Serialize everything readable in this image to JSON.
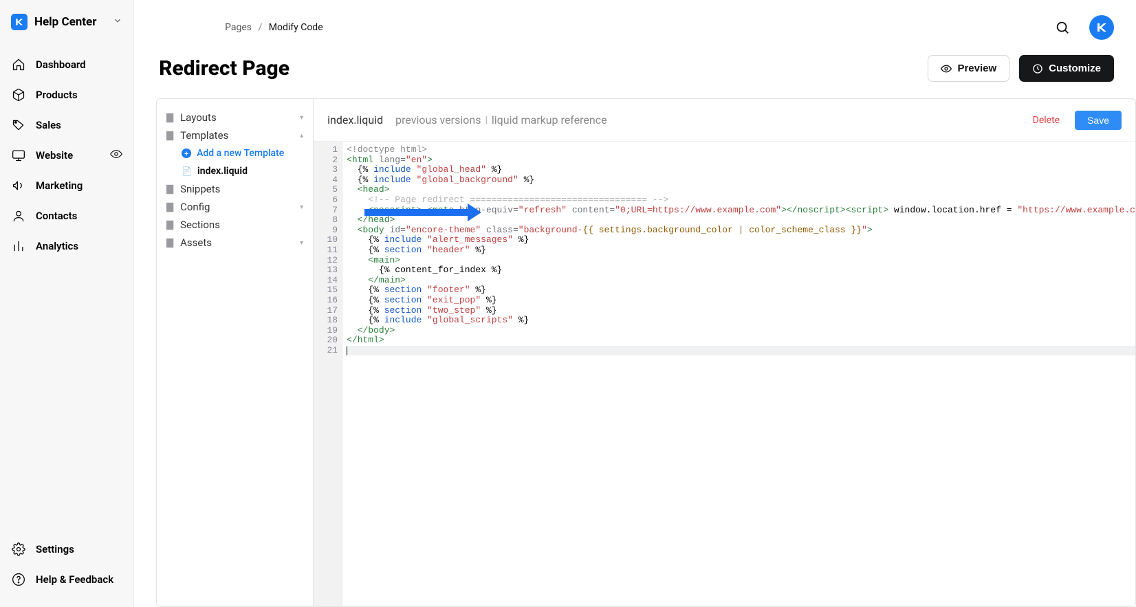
{
  "app_title": "Help Center",
  "nav": [
    {
      "label": "Dashboard",
      "icon": "home"
    },
    {
      "label": "Products",
      "icon": "box"
    },
    {
      "label": "Sales",
      "icon": "tag"
    },
    {
      "label": "Website",
      "icon": "monitor",
      "trailing": "eye"
    },
    {
      "label": "Marketing",
      "icon": "megaphone"
    },
    {
      "label": "Contacts",
      "icon": "user"
    },
    {
      "label": "Analytics",
      "icon": "bars"
    }
  ],
  "footer_nav": [
    {
      "label": "Settings",
      "icon": "gear"
    },
    {
      "label": "Help & Feedback",
      "icon": "question"
    }
  ],
  "breadcrumb": {
    "parent": "Pages",
    "sep": "/",
    "current": "Modify Code"
  },
  "page_title": "Redirect Page",
  "actions": {
    "preview": "Preview",
    "customize": "Customize"
  },
  "tree": {
    "folders": [
      "Layouts",
      "Templates",
      "Snippets",
      "Config",
      "Sections",
      "Assets"
    ],
    "add_template": "Add a new Template",
    "current_file": "index.liquid"
  },
  "editor_header": {
    "filename": "index.liquid",
    "prev": "previous versions",
    "ref": "liquid markup reference",
    "delete": "Delete",
    "save": "Save"
  },
  "code_lines": [
    [
      [
        "s-gray",
        "<!doctype html>"
      ]
    ],
    [
      [
        "s-tag",
        "<html "
      ],
      [
        "s-attr",
        "lang="
      ],
      [
        "s-str",
        "\"en\""
      ],
      [
        "s-tag",
        ">"
      ]
    ],
    [
      [
        "s-text",
        "  {% "
      ],
      [
        "s-kw",
        "include"
      ],
      [
        "s-text",
        " "
      ],
      [
        "s-str",
        "\"global_head\""
      ],
      [
        "s-text",
        " %}"
      ]
    ],
    [
      [
        "s-text",
        "  {% "
      ],
      [
        "s-kw",
        "include"
      ],
      [
        "s-text",
        " "
      ],
      [
        "s-str",
        "\"global_background\""
      ],
      [
        "s-text",
        " %}"
      ]
    ],
    [
      [
        "s-tag",
        "  <head>"
      ]
    ],
    [
      [
        "s-comment",
        "    <!-- Page redirect ================================= -->"
      ]
    ],
    [
      [
        "s-text",
        "    "
      ],
      [
        "s-tag",
        "<noscript>"
      ],
      [
        "s-text",
        " "
      ],
      [
        "s-tag",
        "<meta "
      ],
      [
        "s-attr",
        "http-equiv="
      ],
      [
        "s-str",
        "\"refresh\""
      ],
      [
        "s-text",
        " "
      ],
      [
        "s-attr",
        "content="
      ],
      [
        "s-str",
        "\"0;URL=https://www.example.com\""
      ],
      [
        "s-tag",
        "></noscript><script"
      ],
      [
        "s-tag",
        ">"
      ],
      [
        "s-text",
        " window.location.href = "
      ],
      [
        "s-str",
        "\"https://www.example.c"
      ]
    ],
    [
      [
        "s-tag",
        "  </head>"
      ]
    ],
    [
      [
        "s-tag",
        "  <body "
      ],
      [
        "s-attr",
        "id="
      ],
      [
        "s-str",
        "\"encore-theme\""
      ],
      [
        "s-text",
        " "
      ],
      [
        "s-attr",
        "class="
      ],
      [
        "s-str",
        "\"background-"
      ],
      [
        "s-liq",
        "{{ settings.background_color | color_scheme_class }}"
      ],
      [
        "s-str",
        "\""
      ],
      [
        "s-tag",
        ">"
      ]
    ],
    [
      [
        "s-text",
        "    {% "
      ],
      [
        "s-kw",
        "include"
      ],
      [
        "s-text",
        " "
      ],
      [
        "s-str",
        "\"alert_messages\""
      ],
      [
        "s-text",
        " %}"
      ]
    ],
    [
      [
        "s-text",
        "    {% "
      ],
      [
        "s-kw",
        "section"
      ],
      [
        "s-text",
        " "
      ],
      [
        "s-str",
        "\"header\""
      ],
      [
        "s-text",
        " %}"
      ]
    ],
    [
      [
        "s-tag",
        "    <main>"
      ]
    ],
    [
      [
        "s-text",
        "      {% content_for_index %}"
      ]
    ],
    [
      [
        "s-tag",
        "    </main>"
      ]
    ],
    [
      [
        "s-text",
        "    {% "
      ],
      [
        "s-kw",
        "section"
      ],
      [
        "s-text",
        " "
      ],
      [
        "s-str",
        "\"footer\""
      ],
      [
        "s-text",
        " %}"
      ]
    ],
    [
      [
        "s-text",
        "    {% "
      ],
      [
        "s-kw",
        "section"
      ],
      [
        "s-text",
        " "
      ],
      [
        "s-str",
        "\"exit_pop\""
      ],
      [
        "s-text",
        " %}"
      ]
    ],
    [
      [
        "s-text",
        "    {% "
      ],
      [
        "s-kw",
        "section"
      ],
      [
        "s-text",
        " "
      ],
      [
        "s-str",
        "\"two_step\""
      ],
      [
        "s-text",
        " %}"
      ]
    ],
    [
      [
        "s-text",
        "    {% "
      ],
      [
        "s-kw",
        "include"
      ],
      [
        "s-text",
        " "
      ],
      [
        "s-str",
        "\"global_scripts\""
      ],
      [
        "s-text",
        " %}"
      ]
    ],
    [
      [
        "s-tag",
        "  </body>"
      ]
    ],
    [
      [
        "s-tag",
        "</html>"
      ]
    ],
    [
      [
        "s-text",
        ""
      ]
    ]
  ]
}
